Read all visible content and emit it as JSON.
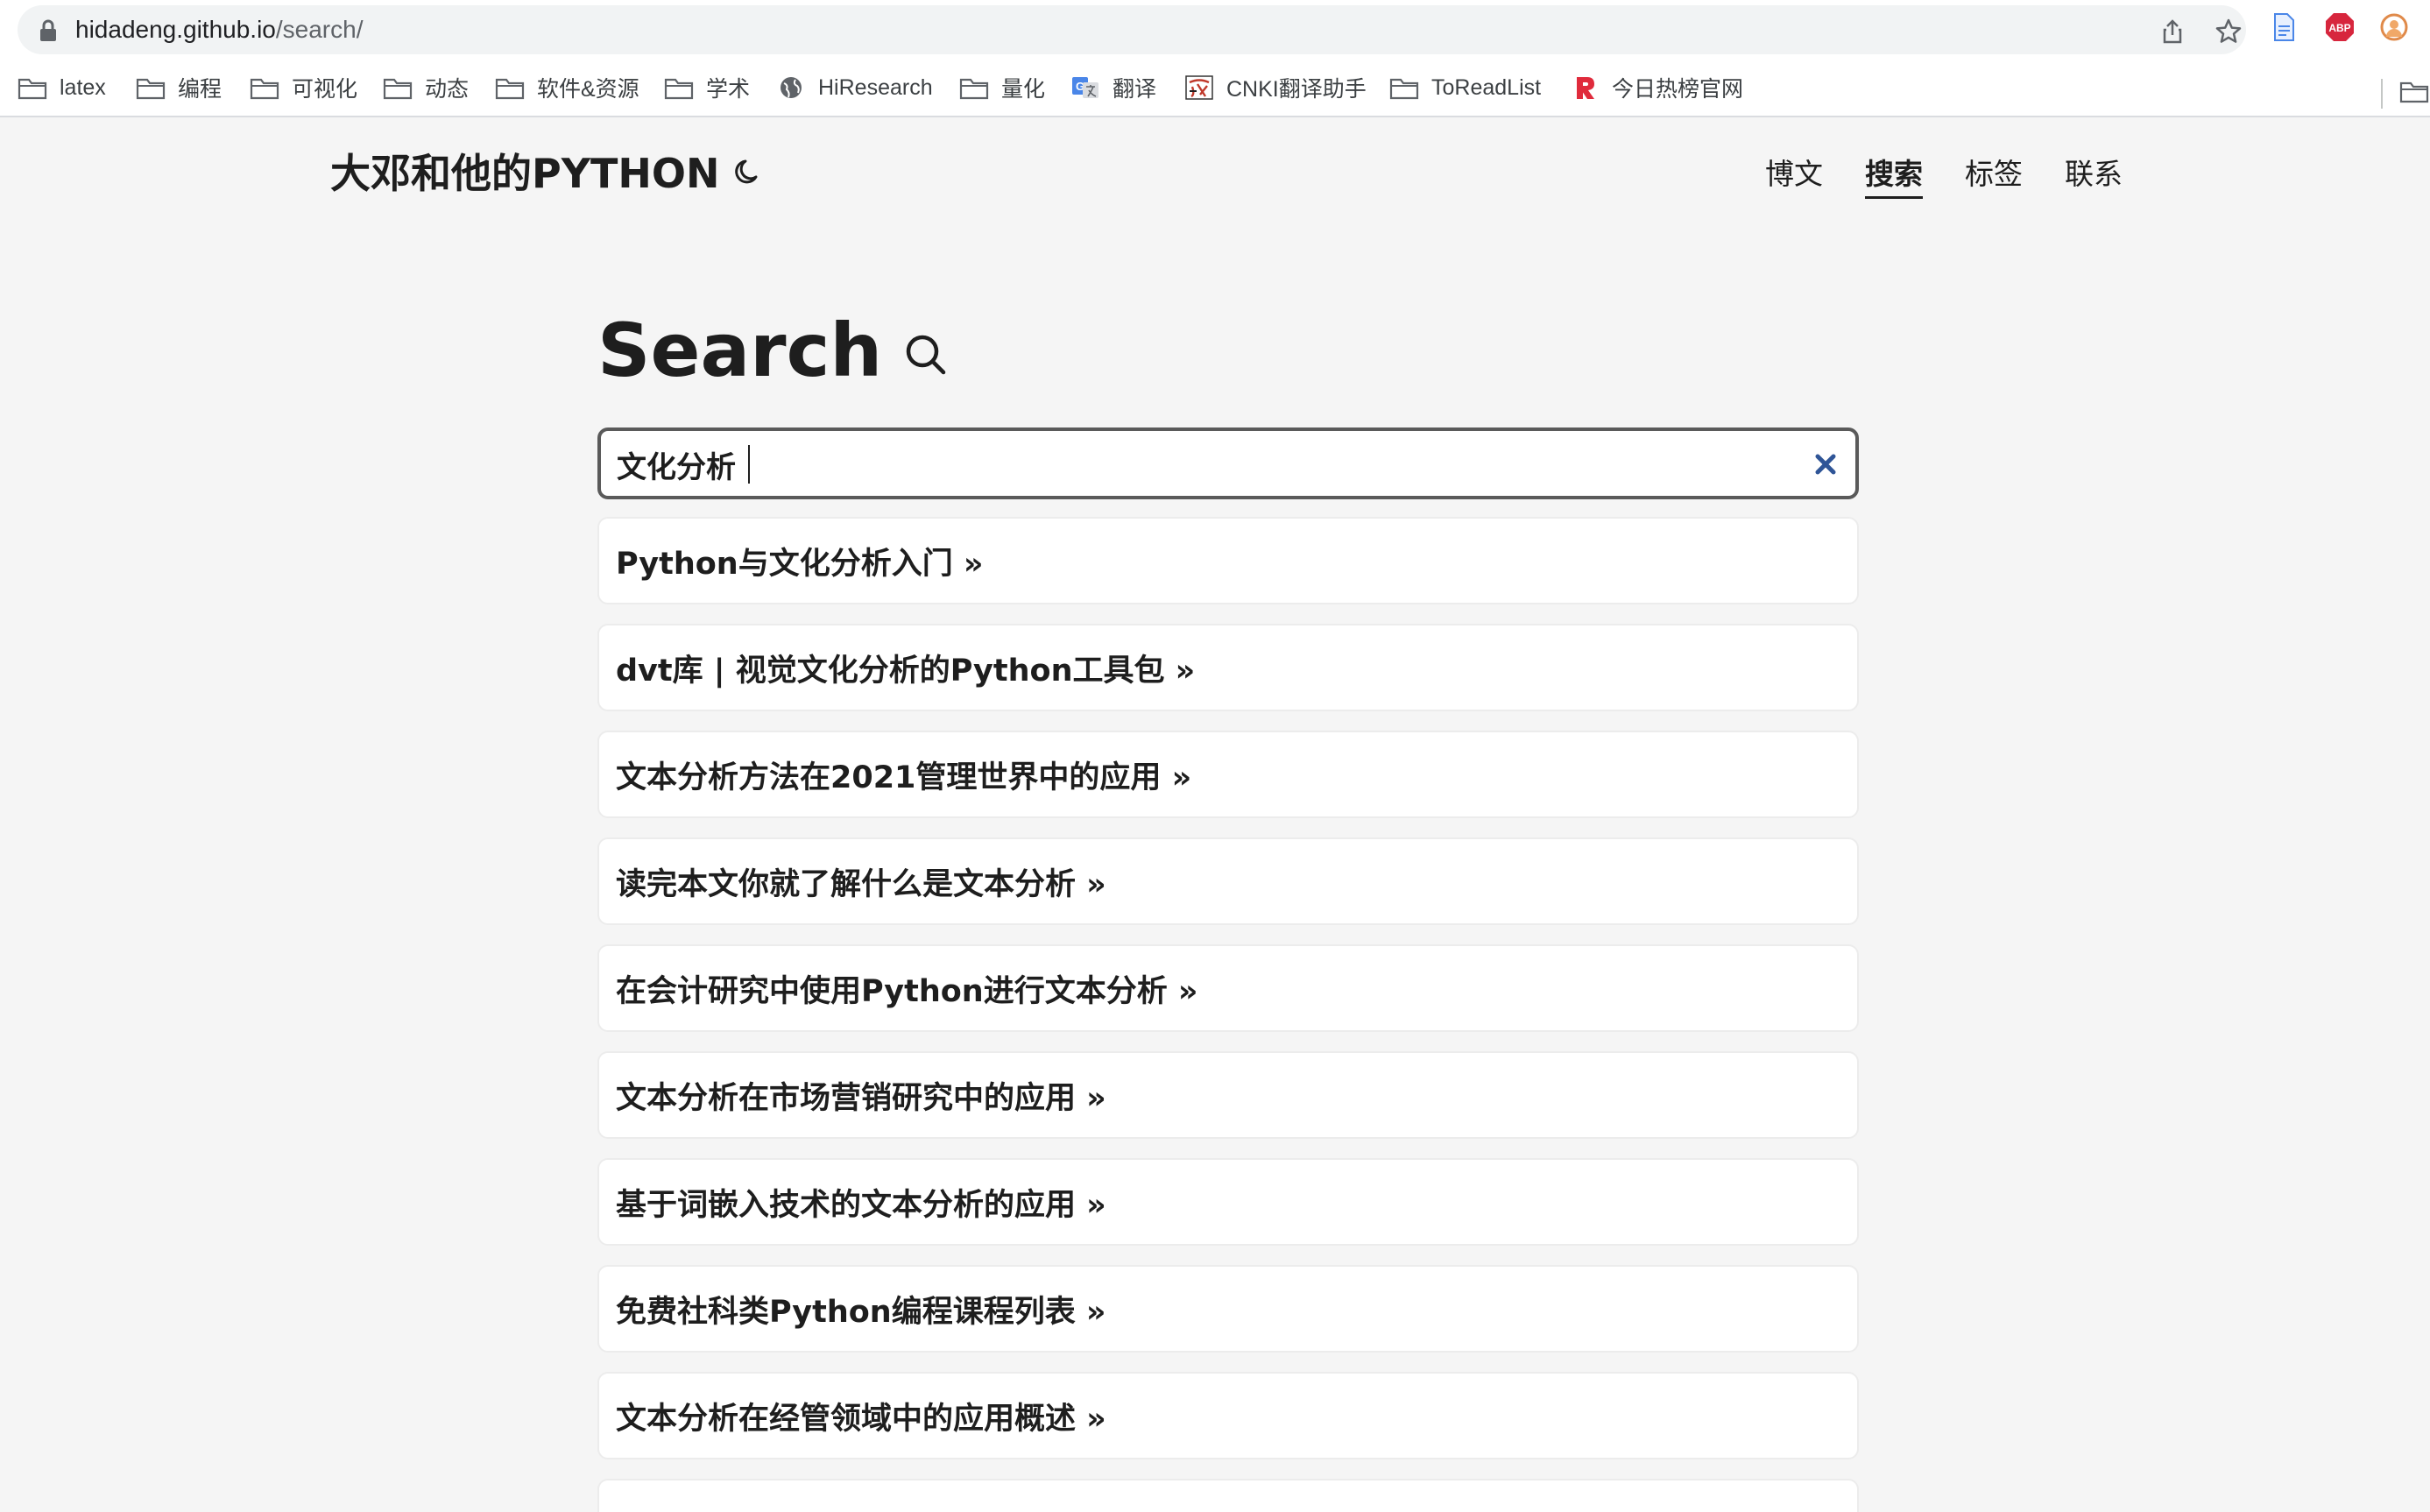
{
  "browser": {
    "url_host": "hidadeng.github.io",
    "url_path": "/search/",
    "bookmarks": [
      {
        "label": "latex",
        "icon": "folder-icon"
      },
      {
        "label": "编程",
        "icon": "folder-icon"
      },
      {
        "label": "可视化",
        "icon": "folder-icon"
      },
      {
        "label": "动态",
        "icon": "folder-icon"
      },
      {
        "label": "软件&资源",
        "icon": "folder-icon"
      },
      {
        "label": "学术",
        "icon": "folder-icon"
      },
      {
        "label": "HiResearch",
        "icon": "globe-icon"
      },
      {
        "label": "量化",
        "icon": "folder-icon"
      },
      {
        "label": "翻译",
        "icon": "google-translate-icon"
      },
      {
        "label": "CNKI翻译助手",
        "icon": "cnki-icon"
      },
      {
        "label": "ToReadList",
        "icon": "folder-icon"
      },
      {
        "label": "今日热榜官网",
        "icon": "rebang-r-icon"
      }
    ],
    "extension_badge": "ABP"
  },
  "header": {
    "site_title": "大邓和他的PYTHON",
    "nav": [
      {
        "label": "博文",
        "active": false
      },
      {
        "label": "搜索",
        "active": true
      },
      {
        "label": "标签",
        "active": false
      },
      {
        "label": "联系",
        "active": false
      }
    ]
  },
  "main": {
    "title": "Search",
    "search_value": "文化分析",
    "results": [
      "Python与文化分析入门 »",
      "dvt库 | 视觉文化分析的Python工具包 »",
      "文本分析方法在2021管理世界中的应用 »",
      "读完本文你就了解什么是文本分析 »",
      "在会计研究中使用Python进行文本分析 »",
      "文本分析在市场营销研究中的应用 »",
      "基于词嵌入技术的文本分析的应用 »",
      "免费社科类Python编程课程列表 »",
      "文本分析在经管领域中的应用概述 »"
    ]
  },
  "colors": {
    "page_bg": "#f5f5f5",
    "card_bg": "#ffffff",
    "text": "#1e1e1e",
    "clear_icon": "#2f5597",
    "abp_red": "#d7263d",
    "rebang_red": "#e02b3c"
  }
}
